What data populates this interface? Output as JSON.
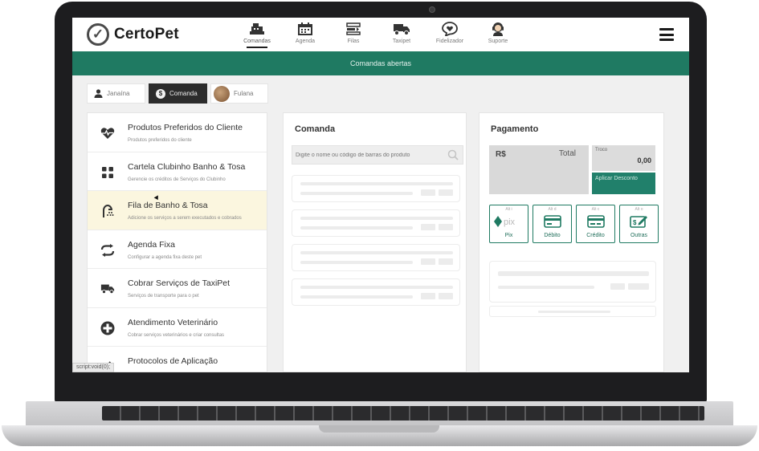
{
  "app": {
    "logo_text": "CertoPet"
  },
  "nav": [
    {
      "id": "comandas",
      "label": "Comandas",
      "icon": "cash-register-icon",
      "active": true
    },
    {
      "id": "agenda",
      "label": "Agenda",
      "icon": "calendar-icon"
    },
    {
      "id": "filas",
      "label": "Filas",
      "icon": "queue-icon"
    },
    {
      "id": "taxipet",
      "label": "Taxipet",
      "icon": "truck-icon"
    },
    {
      "id": "fidelizador",
      "label": "Fidelizador",
      "icon": "heart-chat-icon"
    },
    {
      "id": "suporte",
      "label": "Suporte",
      "icon": "support-agent-icon"
    }
  ],
  "banner": {
    "text": "Comandas abertas"
  },
  "context_tabs": {
    "client": "Janaína",
    "comanda": "Comanda",
    "pet": "Fulana"
  },
  "menu": [
    {
      "title": "Produtos Preferidos do Cliente",
      "subtitle": "Produtos preferidos do cliente",
      "icon": "heart-pulse-icon"
    },
    {
      "title": "Cartela Clubinho Banho & Tosa",
      "subtitle": "Gerencie os créditos de Serviços do Clubinho",
      "icon": "grid-icon"
    },
    {
      "title": "Fila de Banho & Tosa",
      "subtitle": "Adicione os serviços a serem executados e cobrados",
      "icon": "shower-icon",
      "highlighted": true
    },
    {
      "title": "Agenda Fixa",
      "subtitle": "Configurar a agenda fixa deste pet",
      "icon": "repeat-icon"
    },
    {
      "title": "Cobrar Serviços de TaxiPet",
      "subtitle": "Serviços de transporte para o pet",
      "icon": "truck-icon"
    },
    {
      "title": "Atendimento Veterinário",
      "subtitle": "Cobrar serviços veterinários e criar consultas",
      "icon": "medical-cross-icon"
    },
    {
      "title": "Protocolos de Aplicação",
      "subtitle": "",
      "icon": "syringe-icon"
    }
  ],
  "status_bar": "script:void(0);",
  "comanda": {
    "title": "Comanda",
    "search_placeholder": "Digite o nome ou código de barras do produto"
  },
  "pagamento": {
    "title": "Pagamento",
    "currency": "R$",
    "total_label": "Total",
    "troco_label": "Troco",
    "troco_value": "0,00",
    "discount_button": "Aplicar Desconto",
    "methods": [
      {
        "shortcut": "Alt i",
        "label": "Pix",
        "icon": "pix-icon"
      },
      {
        "shortcut": "Alt d",
        "label": "Débito",
        "icon": "debit-card-icon"
      },
      {
        "shortcut": "Alt c",
        "label": "Crédito",
        "icon": "credit-card-icon"
      },
      {
        "shortcut": "Alt o",
        "label": "Outras",
        "icon": "other-payment-icon"
      }
    ]
  },
  "colors": {
    "brand": "#1f7a62",
    "highlight": "#fbf6df"
  }
}
